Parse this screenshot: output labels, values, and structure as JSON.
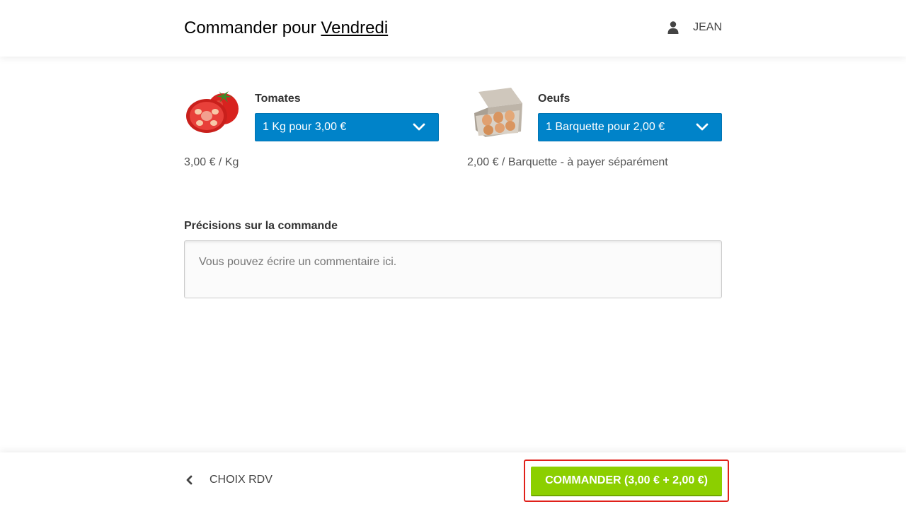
{
  "header": {
    "title_prefix": "Commander pour",
    "title_day": "Vendredi",
    "user_icon": "user-icon",
    "user_name": "JEAN"
  },
  "products": [
    {
      "name": "Tomates",
      "image_icon": "tomato-image",
      "selected_option": "1 Kg pour 3,00 €",
      "unit_price": "3,00 € / Kg"
    },
    {
      "name": "Oeufs",
      "image_icon": "eggs-carton-image",
      "selected_option": "1 Barquette pour 2,00 €",
      "unit_price": "2,00 € / Barquette - à payer séparément"
    }
  ],
  "notes": {
    "label": "Précisions sur la commande",
    "placeholder": "Vous pouvez écrire un commentaire ici.",
    "value": ""
  },
  "footer": {
    "back_icon": "chevron-left-icon",
    "back_label": "CHOIX RDV",
    "order_label": "COMMANDER (3,00 € + 2,00 €)"
  },
  "colors": {
    "select_bg": "#0083c9",
    "order_bg": "#8ccf00",
    "highlight_outline": "#e0201a"
  }
}
